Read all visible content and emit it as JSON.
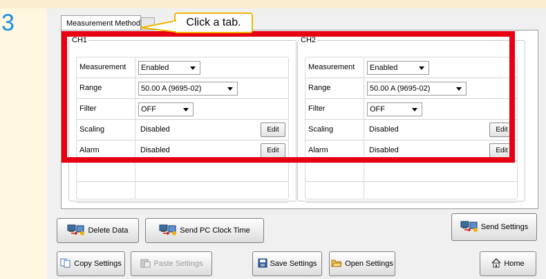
{
  "step_number": "3",
  "callout": {
    "text": "Click a tab."
  },
  "tabs": {
    "active": "Measurement Method"
  },
  "channels": [
    {
      "title": "CH1",
      "rows": [
        {
          "label": "Measurement",
          "value": "Enabled",
          "type": "dropdown"
        },
        {
          "label": "Range",
          "value": "50.00 A (9695-02)",
          "type": "dropdown"
        },
        {
          "label": "Filter",
          "value": "OFF",
          "type": "dropdown"
        },
        {
          "label": "Scaling",
          "value": "Disabled",
          "type": "edit",
          "button": "Edit"
        },
        {
          "label": "Alarm",
          "value": "Disabled",
          "type": "edit",
          "button": "Edit"
        }
      ]
    },
    {
      "title": "CH2",
      "rows": [
        {
          "label": "Measurement",
          "value": "Enabled",
          "type": "dropdown"
        },
        {
          "label": "Range",
          "value": "50.00 A (9695-02)",
          "type": "dropdown"
        },
        {
          "label": "Filter",
          "value": "OFF",
          "type": "dropdown"
        },
        {
          "label": "Scaling",
          "value": "Disabled",
          "type": "edit",
          "button": "Edit"
        },
        {
          "label": "Alarm",
          "value": "Disabled",
          "type": "edit",
          "button": "Edit"
        }
      ]
    }
  ],
  "buttons": {
    "delete_data": "Delete Data",
    "send_clock": "Send PC Clock Time",
    "send_settings": "Send Settings",
    "copy_settings": "Copy Settings",
    "paste_settings": "Paste Settings",
    "save_settings": "Save Settings",
    "open_settings": "Open Settings",
    "home": "Home"
  },
  "colors": {
    "highlight": "#e60012",
    "callout_border": "#f0b400",
    "step_number": "#1a8ce0"
  }
}
